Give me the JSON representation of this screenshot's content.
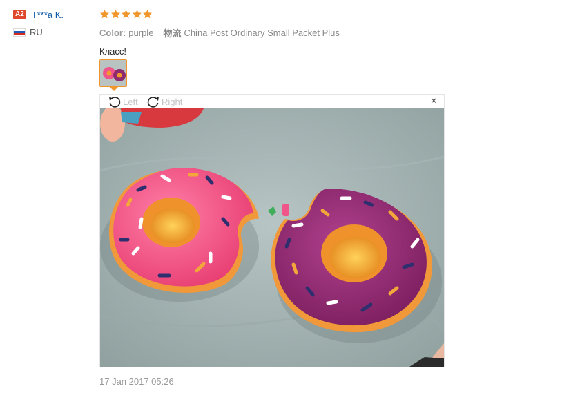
{
  "user": {
    "level_badge": "A2",
    "name": "T***a K.",
    "country": "RU",
    "flag_icon": "russia-flag-icon",
    "flag_colors": [
      "#ffffff",
      "#1f5bb6",
      "#d52b1e"
    ]
  },
  "review": {
    "rating": 5,
    "rating_max": 5,
    "star_color": "#f0962b",
    "color_label": "Color:",
    "color_value": "purple",
    "shipping_label": "物流",
    "shipping_value": "China Post Ordinary Small Packet Plus",
    "text": "Класс!",
    "date": "17 Jan 2017 05:26"
  },
  "viewer": {
    "rotate_left_label": "Left",
    "rotate_right_label": "Right",
    "close_label": "×",
    "rotate_left_icon": "rotate-left-icon",
    "rotate_right_icon": "rotate-right-icon",
    "close_icon": "close-icon",
    "accent_color": "#f0962b"
  }
}
